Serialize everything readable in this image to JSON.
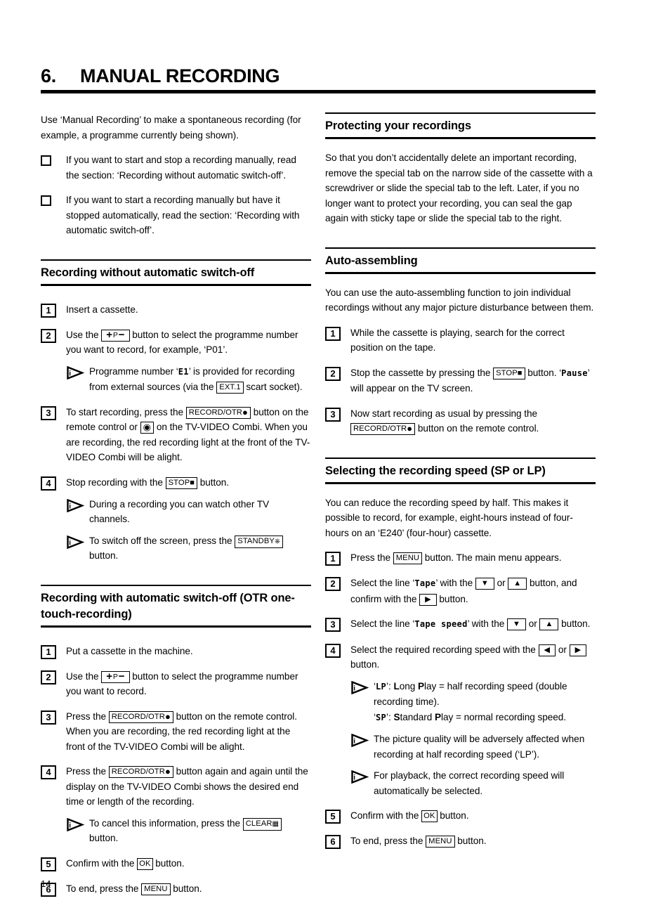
{
  "chapter": {
    "number": "6.",
    "title": "MANUAL RECORDING"
  },
  "folio": "14",
  "left_column": {
    "intro": "Use ‘Manual Recording’ to make a spontaneous recording (for example, a programme currently being shown).",
    "checklist": [
      "If you want to start and stop a recording manually, read the section: ‘Recording without automatic switch-off’.",
      "If you want to start a recording manually but have it stopped automatically, read the section: ‘Recording with automatic switch-off’."
    ],
    "section1": {
      "heading": "Recording without automatic switch-off",
      "steps": [
        {
          "num": "1",
          "text": "Insert a cassette."
        },
        {
          "num": "2",
          "text_a": "Use the",
          "key": "+P−",
          "text_b": "button to select the programme number you want to record, for example, ‘P01’.",
          "tip": {
            "text_a": "Programme number ‘",
            "mono": "E1",
            "text_b": "’ is provided for recording from external sources (via the",
            "key": "EXT.1",
            "text_c": "scart socket)."
          }
        },
        {
          "num": "3",
          "text_a": "To start recording, press the",
          "key": "RECORD/OTR",
          "text_b": "button on the remote control or",
          "key2": "record-dot",
          "text_c": "on the TV-VIDEO Combi. When you are recording, the red recording light at the front of the TV-VIDEO Combi will be alight."
        },
        {
          "num": "4",
          "text_a": "Stop recording with the",
          "key": "STOP",
          "text_b": "button.",
          "tips": [
            {
              "text": "During a recording you can watch other TV channels."
            },
            {
              "text_a": "To switch off the screen, press the",
              "key": "STANDBY",
              "text_b": "button."
            }
          ]
        }
      ]
    },
    "section2": {
      "heading": "Recording with automatic switch-off (OTR one-touch-recording)",
      "steps": [
        {
          "num": "1",
          "text": "Put a cassette in the machine."
        },
        {
          "num": "2",
          "text_a": "Use the",
          "key": "+P−",
          "text_b": "button to select the programme number you want to record."
        },
        {
          "num": "3",
          "text_a": "Press the",
          "key": "RECORD/OTR",
          "text_b": "button on the remote control. When you are recording, the red recording light at the front of the TV-VIDEO Combi will be alight."
        },
        {
          "num": "4",
          "text_a": "Press the",
          "key": "RECORD/OTR",
          "text_b": "button again and again until the display on the TV-VIDEO Combi shows the desired end time or length of the recording.",
          "tip": {
            "text_a": "To cancel this information, press the",
            "key": "CLEAR",
            "text_b": "button."
          }
        },
        {
          "num": "5",
          "text_a": "Confirm with the",
          "key": "OK",
          "text_b": "button."
        },
        {
          "num": "6",
          "text_a": "To end, press the",
          "key": "MENU",
          "text_b": "button."
        }
      ]
    }
  },
  "right_column": {
    "section1": {
      "heading": "Protecting your recordings",
      "body": "So that you don’t accidentally delete an important recording, remove the special tab on the narrow side of the cassette with a screwdriver or slide the special tab to the left. Later, if you no longer want to protect your recording, you can seal the gap again with sticky tape or slide the special tab to the right."
    },
    "section2": {
      "heading": "Auto-assembling",
      "body": "You can use the auto-assembling function to join individual recordings without any major picture disturbance between them.",
      "steps": [
        {
          "num": "1",
          "text": "While the cassette is playing, search for the correct position on the tape."
        },
        {
          "num": "2",
          "text_a": "Stop the cassette by pressing the",
          "key": "STOP",
          "text_b": "button. ‘",
          "mono": "Pause",
          "text_c": "’ will appear on the TV screen."
        },
        {
          "num": "3",
          "text_a": "Now start recording as usual by pressing the",
          "key": "RECORD/OTR",
          "text_b": "button on the remote control."
        }
      ]
    },
    "section3": {
      "heading": "Selecting the recording speed (SP or LP)",
      "body": "You can reduce the recording speed by half. This makes it possible to record, for example, eight-hours instead of four-hours on an ‘E240’ (four-hour) cassette.",
      "steps": [
        {
          "num": "1",
          "text_a": "Press the",
          "key": "MENU",
          "text_b": "button. The main menu appears."
        },
        {
          "num": "2",
          "text_a": "Select the line ‘",
          "mono": "Tape",
          "text_b": "’ with the",
          "key_down": "▼",
          "text_c": "or",
          "key_up": "▲",
          "text_d": "button, and confirm with the",
          "key_right": "▶",
          "text_e": "button."
        },
        {
          "num": "3",
          "text_a": "Select the line ‘",
          "mono": "Tape  speed",
          "text_b": "’ with the",
          "key_down": "▼",
          "text_c": "or",
          "key_up": "▲",
          "text_d": "button."
        },
        {
          "num": "4",
          "text_a": "Select the required recording speed with the",
          "key_left": "◀",
          "text_b": "or",
          "key_right": "▶",
          "text_c": "button.",
          "tips": [
            {
              "mono1": "LP",
              "line1_a": "‘",
              "line1_b": "’: ",
              "bold_l": "L",
              "line1_c": "ong ",
              "bold_p": "P",
              "line1_d": "lay = half recording speed (double recording time).",
              "mono2": "SP",
              "line2_a": "‘",
              "line2_b": "’: ",
              "bold_s": "S",
              "line2_c": "tandard ",
              "bold_p2": "P",
              "line2_d": "lay = normal recording speed."
            },
            {
              "text": "The picture quality will be adversely affected when recording at half recording speed (‘LP’)."
            },
            {
              "text": "For playback, the correct recording speed will automatically be selected."
            }
          ]
        },
        {
          "num": "5",
          "text_a": "Confirm with the",
          "key": "OK",
          "text_b": "button."
        },
        {
          "num": "6",
          "text_a": "To end, press the",
          "key": "MENU",
          "text_b": "button."
        }
      ]
    }
  },
  "icons": {
    "tip": "tip-triangle-icon",
    "checkbox": "checkbox-square-icon",
    "record": "record-dot-icon",
    "stop": "stop-square-icon",
    "standby": "standby-power-icon",
    "clear": "clear-lines-icon"
  }
}
